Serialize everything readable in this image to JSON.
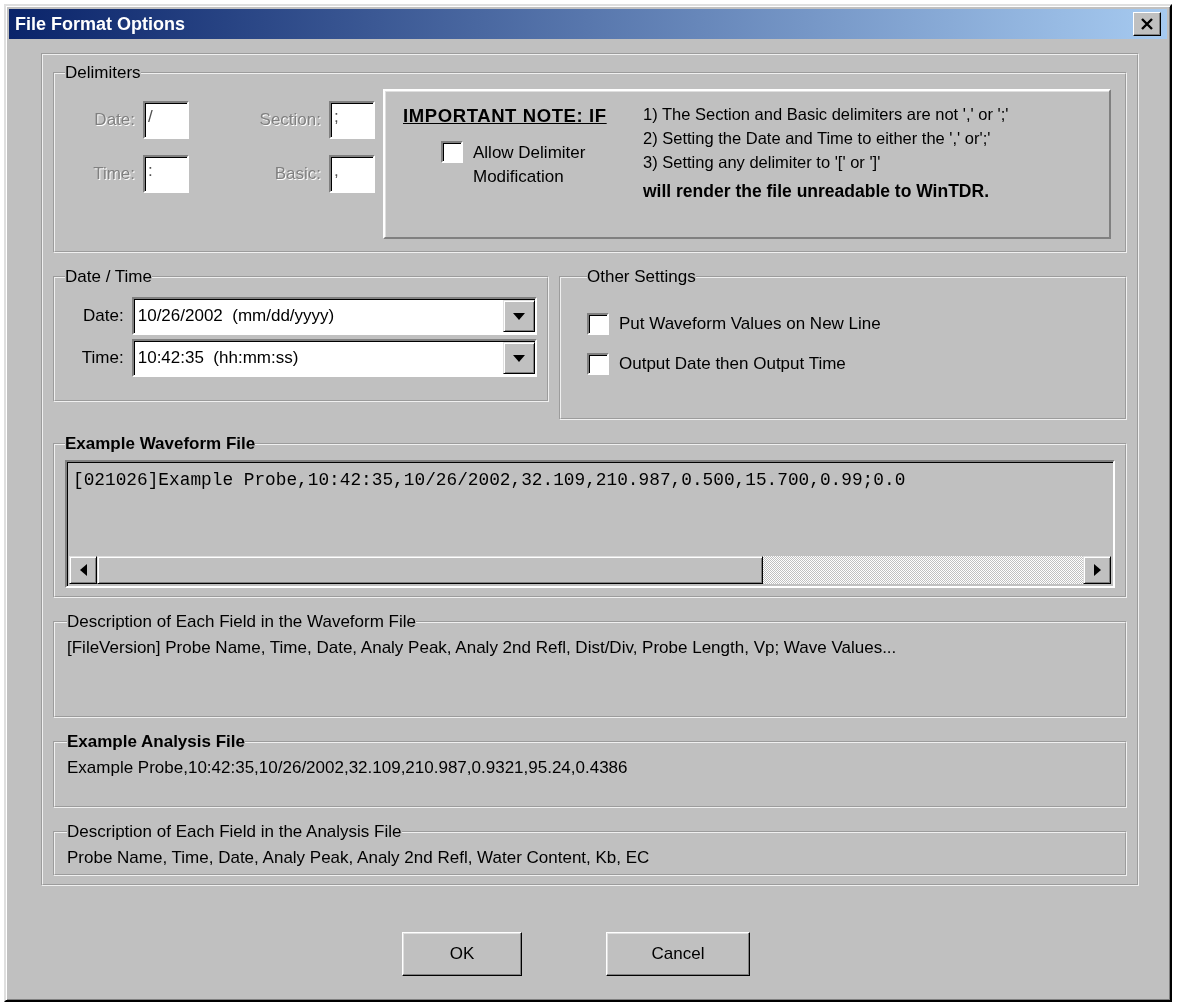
{
  "window": {
    "title": "File Format Options"
  },
  "delimiters": {
    "title": "Delimiters",
    "disabled": true,
    "fields": [
      {
        "label": "Date:",
        "value": "/"
      },
      {
        "label": "Section:",
        "value": ";"
      },
      {
        "label": "Time:",
        "value": ":"
      },
      {
        "label": "Basic:",
        "value": ","
      }
    ]
  },
  "note": {
    "heading": "IMPORTANT NOTE: IF",
    "checkbox": {
      "label": "Allow Delimiter Modification",
      "checked": false
    },
    "lines": [
      "1) The Section and Basic delimiters are not ',' or ';'",
      "2) Setting the Date and Time to either the ',' or';'",
      "3) Setting any delimiter to '[' or ']'"
    ],
    "conclusion": "will render the file unreadable to WinTDR."
  },
  "date_time": {
    "title": "Date / Time",
    "fields": [
      {
        "label": "Date:",
        "value": "10/26/2002  (mm/dd/yyyy)"
      },
      {
        "label": "Time:",
        "value": "10:42:35  (hh:mm:ss)"
      }
    ]
  },
  "other_settings": {
    "title": "Other Settings",
    "options": [
      {
        "label": "Put Waveform Values on New Line",
        "checked": false
      },
      {
        "label": "Output Date then Output Time",
        "checked": false
      }
    ]
  },
  "example_waveform": {
    "title": "Example Waveform File",
    "text": "[021026]Example Probe,10:42:35,10/26/2002,32.109,210.987,0.500,15.700,0.99;0.0"
  },
  "waveform_description": {
    "title": "Description of Each Field in the Waveform File",
    "text": "[FileVersion] Probe Name, Time, Date, Analy Peak, Analy 2nd Refl, Dist/Div, Probe Length, Vp; Wave Values..."
  },
  "example_analysis": {
    "title": "Example Analysis File",
    "text": "Example Probe,10:42:35,10/26/2002,32.109,210.987,0.9321,95.24,0.4386"
  },
  "analysis_description": {
    "title": "Description of Each Field in the Analysis File",
    "text": "Probe Name, Time, Date, Analy Peak, Analy 2nd Refl, Water Content, Kb, EC"
  },
  "buttons": [
    "OK",
    "Cancel"
  ]
}
